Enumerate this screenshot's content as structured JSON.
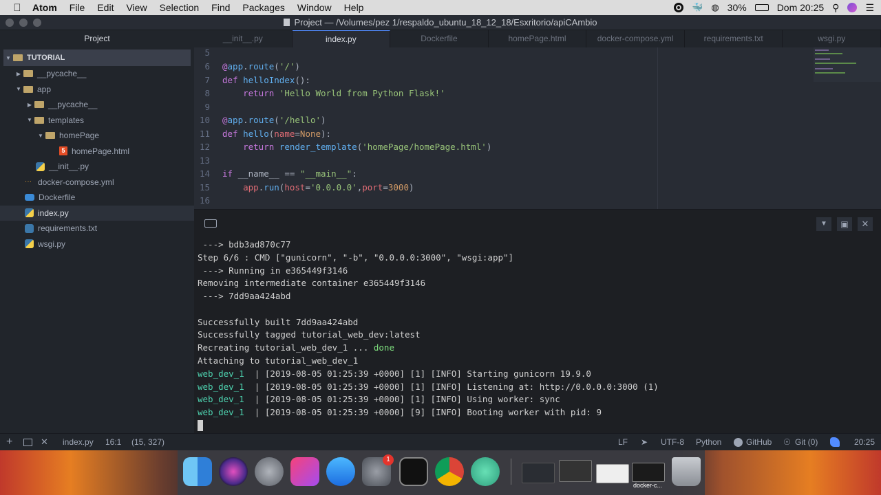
{
  "menubar": {
    "app": "Atom",
    "items": [
      "File",
      "Edit",
      "View",
      "Selection",
      "Find",
      "Packages",
      "Window",
      "Help"
    ],
    "battery": "30%",
    "clock": "Dom 20:25"
  },
  "window": {
    "title": "Project — /Volumes/pez 1/respaldo_ubuntu_18_12_18/Esxritorio/apiCAmbio"
  },
  "sidebar": {
    "header": "Project",
    "root": "TUTORIAL",
    "items": [
      {
        "label": "__pycache__",
        "type": "folder"
      },
      {
        "label": "app",
        "type": "folder"
      },
      {
        "label": "__pycache__",
        "type": "folder"
      },
      {
        "label": "templates",
        "type": "folder"
      },
      {
        "label": "homePage",
        "type": "folder"
      },
      {
        "label": "homePage.html",
        "type": "html"
      },
      {
        "label": "__init__.py",
        "type": "python"
      },
      {
        "label": "docker-compose.yml",
        "type": "yaml"
      },
      {
        "label": "Dockerfile",
        "type": "docker"
      },
      {
        "label": "index.py",
        "type": "python"
      },
      {
        "label": "requirements.txt",
        "type": "text"
      },
      {
        "label": "wsgi.py",
        "type": "python"
      }
    ]
  },
  "tabs": [
    "__init__.py",
    "index.py",
    "Dockerfile",
    "homePage.html",
    "docker-compose.yml",
    "requirements.txt",
    "wsgi.py"
  ],
  "editor": {
    "line_numbers": [
      "5",
      "6",
      "7",
      "8",
      "9",
      "10",
      "11",
      "12",
      "13",
      "14",
      "15",
      "16"
    ]
  },
  "terminal": {
    "lines": [
      " ---> bdb3ad870c77",
      "Step 6/6 : CMD [\"gunicorn\", \"-b\", \"0.0.0.0:3000\", \"wsgi:app\"]",
      " ---> Running in e365449f3146",
      "Removing intermediate container e365449f3146",
      " ---> 7dd9aa424abd",
      "",
      "Successfully built 7dd9aa424abd",
      "Successfully tagged tutorial_web_dev:latest",
      "Recreating tutorial_web_dev_1 ... ",
      "Attaching to tutorial_web_dev_1"
    ],
    "done_label": "done",
    "log_prefix": "web_dev_1",
    "log_lines": [
      "  | [2019-08-05 01:25:39 +0000] [1] [INFO] Starting gunicorn 19.9.0",
      "  | [2019-08-05 01:25:39 +0000] [1] [INFO] Listening at: http://0.0.0.0:3000 (1)",
      "  | [2019-08-05 01:25:39 +0000] [1] [INFO] Using worker: sync",
      "  | [2019-08-05 01:25:39 +0000] [9] [INFO] Booting worker with pid: 9"
    ]
  },
  "statusbar": {
    "file": "index.py",
    "cursor": "16:1",
    "selection": "(15, 327)",
    "line_ending": "LF",
    "encoding": "UTF-8",
    "grammar": "Python",
    "github": "GitHub",
    "git": "Git (0)",
    "time": "20:25"
  },
  "dock": {
    "badge": "1",
    "label": "docker-c..."
  }
}
